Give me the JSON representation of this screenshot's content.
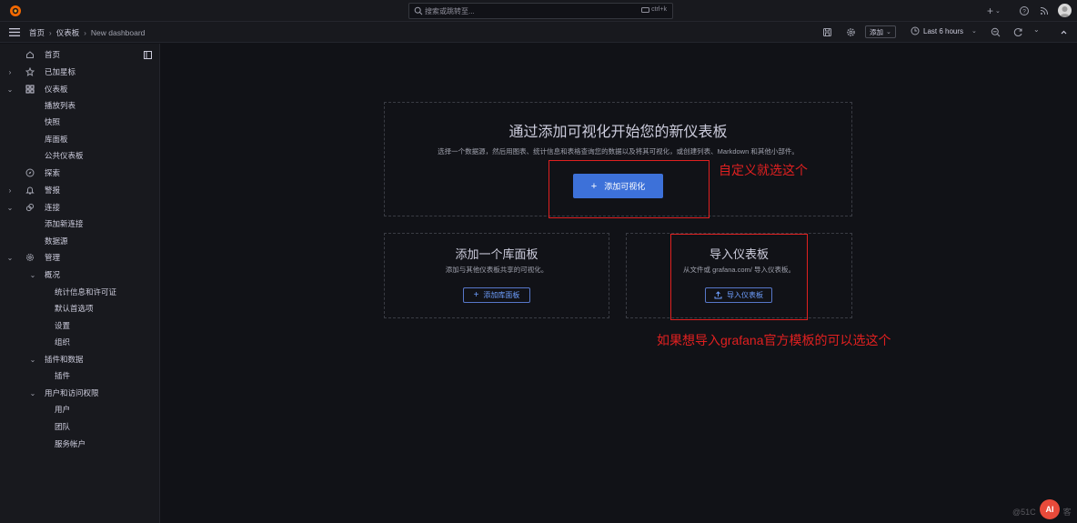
{
  "topbar": {
    "search_placeholder": "搜索或跳转至...",
    "search_shortcut": "ctrl+k",
    "plus_label": "+"
  },
  "navbar": {
    "breadcrumbs": [
      "首页",
      "仪表板",
      "New dashboard"
    ],
    "add_label": "添加",
    "time_range": "Last 6 hours"
  },
  "sidebar": {
    "items": [
      {
        "label": "首页",
        "icon": "home-icon"
      },
      {
        "label": "已加星标",
        "icon": "star-icon"
      },
      {
        "label": "仪表板",
        "icon": "dashboard-grid-icon"
      },
      {
        "label": "播放列表"
      },
      {
        "label": "快照"
      },
      {
        "label": "库面板"
      },
      {
        "label": "公共仪表板"
      },
      {
        "label": "探索",
        "icon": "compass-icon"
      },
      {
        "label": "警报",
        "icon": "bell-icon"
      },
      {
        "label": "连接",
        "icon": "link-icon"
      },
      {
        "label": "添加新连接"
      },
      {
        "label": "数据源"
      },
      {
        "label": "管理",
        "icon": "gear-icon"
      },
      {
        "label": "概况"
      },
      {
        "label": "统计信息和许可证"
      },
      {
        "label": "默认首选项"
      },
      {
        "label": "设置"
      },
      {
        "label": "组织"
      },
      {
        "label": "插件和数据"
      },
      {
        "label": "插件"
      },
      {
        "label": "用户和访问权限"
      },
      {
        "label": "用户"
      },
      {
        "label": "团队"
      },
      {
        "label": "服务帐户"
      }
    ]
  },
  "main": {
    "hero_title": "通过添加可视化开始您的新仪表板",
    "hero_desc": "选择一个数据源，然后用图表、统计信息和表格查询您的数据以及将其可视化，或创建列表、Markdown 和其他小部件。",
    "add_viz_label": "添加可视化",
    "library_title": "添加一个库面板",
    "library_desc": "添加与其他仪表板共享的可视化。",
    "library_button": "添加库面板",
    "import_title": "导入仪表板",
    "import_desc": "从文件或 grafana.com/ 导入仪表板。",
    "import_button": "导入仪表板"
  },
  "annotations": {
    "custom": "自定义就选这个",
    "import": "如果想导入grafana官方模板的可以选这个"
  },
  "watermark": {
    "text": "@51C",
    "suffix": "客",
    "badge": "AI"
  },
  "colors": {
    "primary": "#3d71d9",
    "annotation_red": "#e02020",
    "background": "#111217"
  }
}
